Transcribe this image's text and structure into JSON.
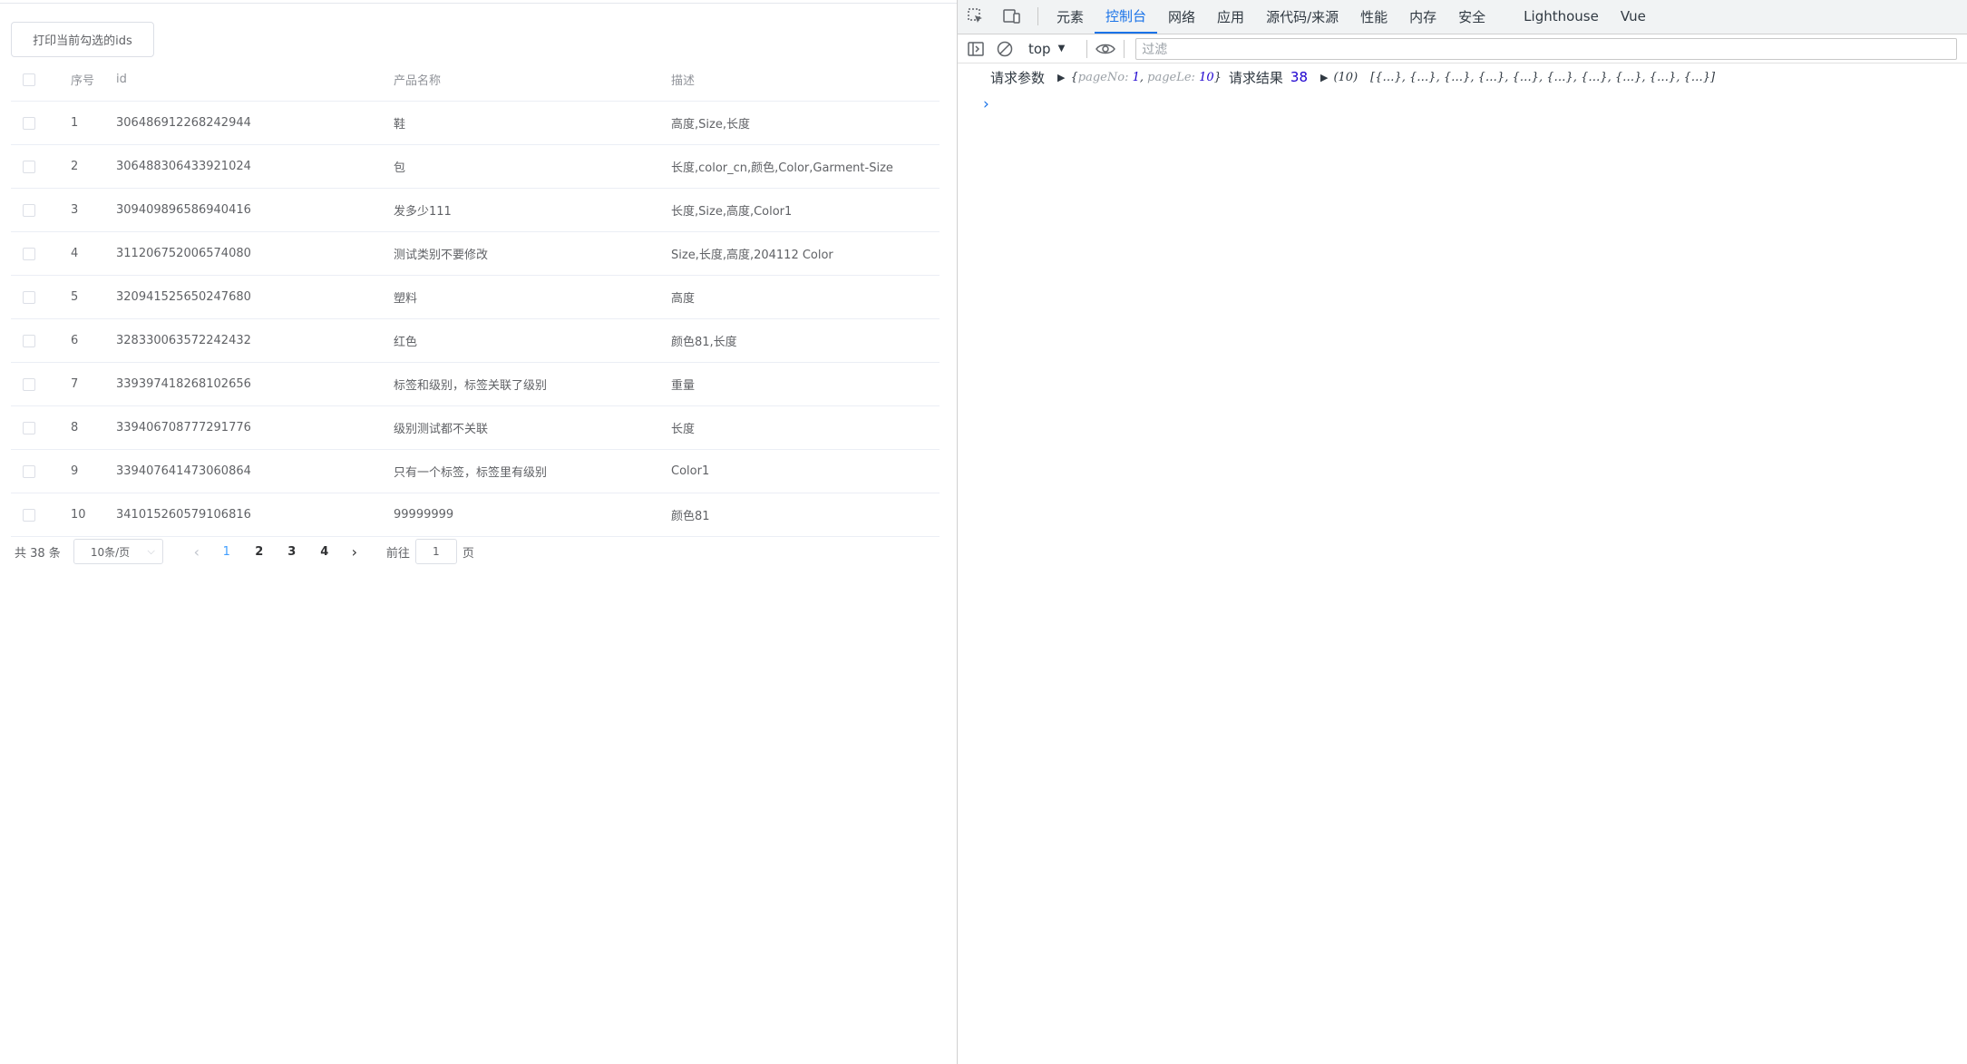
{
  "page": {
    "print_button": "打印当前勾选的ids",
    "columns": [
      "序号",
      "id",
      "产品名称",
      "描述"
    ],
    "rows": [
      {
        "idx": "1",
        "id": "306486912268242944",
        "name": "鞋",
        "desc": "高度,Size,长度"
      },
      {
        "idx": "2",
        "id": "306488306433921024",
        "name": "包",
        "desc": "长度,color_cn,颜色,Color,Garment-Size"
      },
      {
        "idx": "3",
        "id": "309409896586940416",
        "name": "发多少111",
        "desc": "长度,Size,高度,Color1"
      },
      {
        "idx": "4",
        "id": "311206752006574080",
        "name": "测试类别不要修改",
        "desc": "Size,长度,高度,204112 Color"
      },
      {
        "idx": "5",
        "id": "320941525650247680",
        "name": "塑料",
        "desc": "高度"
      },
      {
        "idx": "6",
        "id": "328330063572242432",
        "name": "红色",
        "desc": "颜色81,长度"
      },
      {
        "idx": "7",
        "id": "339397418268102656",
        "name": "标签和级别，标签关联了级别",
        "desc": "重量"
      },
      {
        "idx": "8",
        "id": "339406708777291776",
        "name": "级别测试都不关联",
        "desc": "长度"
      },
      {
        "idx": "9",
        "id": "339407641473060864",
        "name": "只有一个标签，标签里有级别",
        "desc": "Color1"
      },
      {
        "idx": "10",
        "id": "341015260579106816",
        "name": "99999999",
        "desc": "颜色81"
      }
    ],
    "pagination": {
      "total": "共 38 条",
      "page_size": "10条/页",
      "pages": [
        "1",
        "2",
        "3",
        "4"
      ],
      "current": "1",
      "goto_label": "前往",
      "goto_value": "1",
      "goto_suffix": "页"
    }
  },
  "devtools": {
    "tabs": [
      "元素",
      "控制台",
      "网络",
      "应用",
      "源代码/来源",
      "性能",
      "内存",
      "安全",
      "Lighthouse",
      "Vue"
    ],
    "active_tab": "控制台",
    "context": "top",
    "filter_placeholder": "过滤",
    "log": {
      "label1": "请求参数",
      "params_open": "{",
      "k1": "pageNo",
      "v1": "1",
      "k2": "pageLe",
      "v2": "10",
      "params_close": "}",
      "label2": "请求结果",
      "count": "38",
      "array_len": "(10)",
      "array_preview": "[{…}, {…}, {…}, {…}, {…}, {…}, {…}, {…}, {…}, {…}]"
    },
    "prompt": "›"
  }
}
